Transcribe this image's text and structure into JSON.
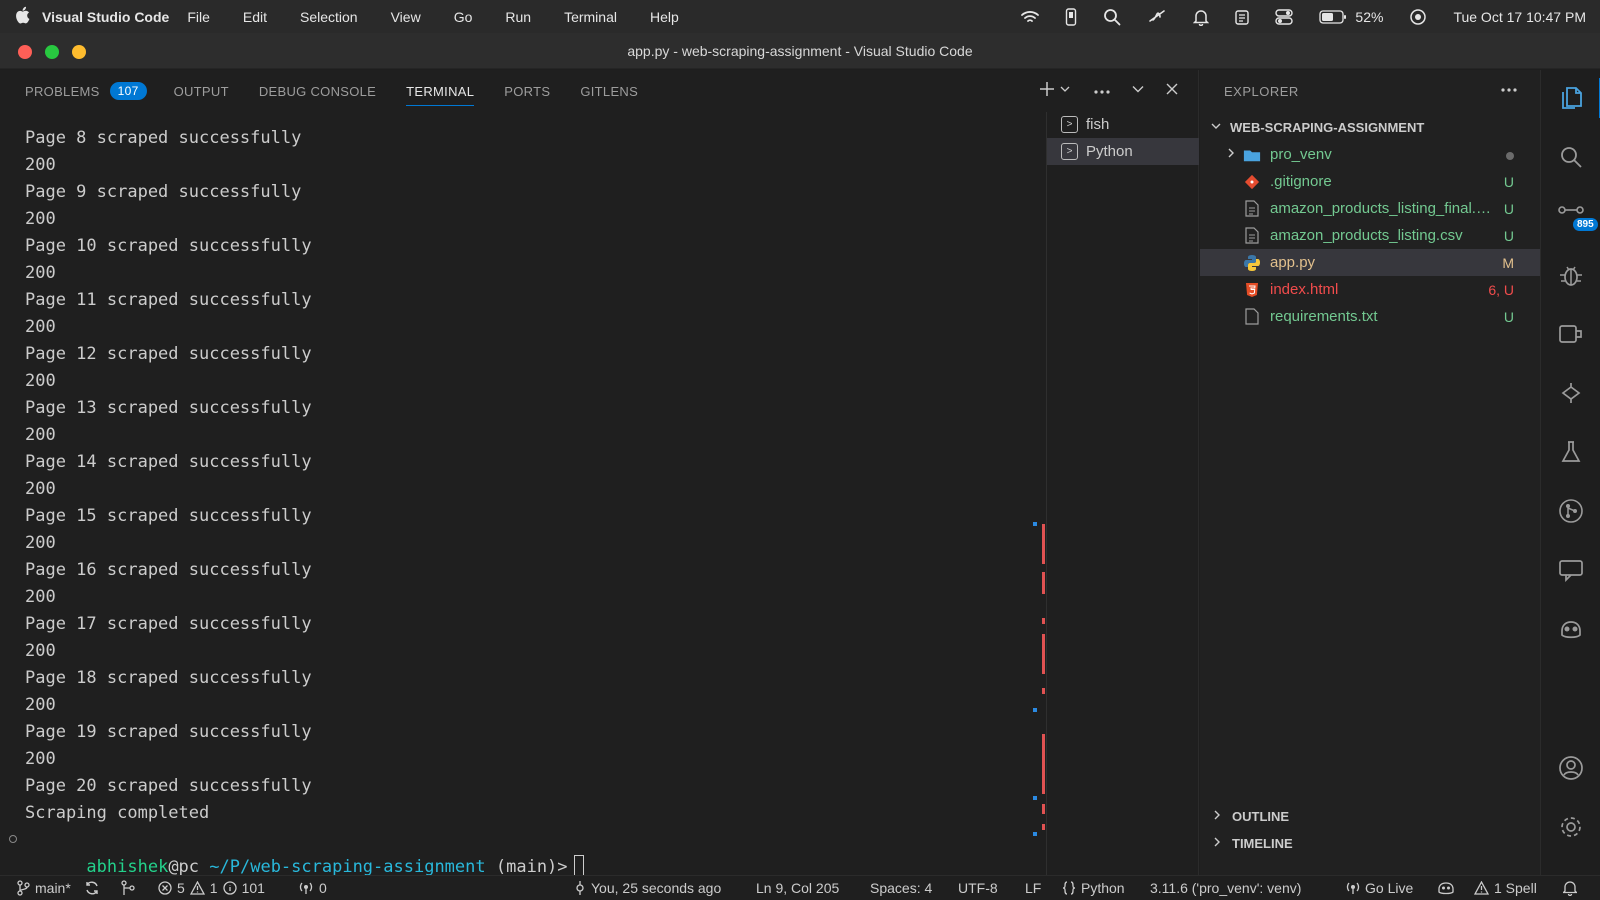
{
  "menubar": {
    "app_name": "Visual Studio Code",
    "items": [
      "File",
      "Edit",
      "Selection",
      "View",
      "Go",
      "Run",
      "Terminal",
      "Help"
    ],
    "battery": "52%",
    "datetime": "Tue Oct 17  10:47 PM"
  },
  "window": {
    "title": "app.py - web-scraping-assignment - Visual Studio Code"
  },
  "panel": {
    "tabs": [
      {
        "label": "PROBLEMS",
        "badge": "107"
      },
      {
        "label": "OUTPUT"
      },
      {
        "label": "DEBUG CONSOLE"
      },
      {
        "label": "TERMINAL",
        "active": true
      },
      {
        "label": "PORTS"
      },
      {
        "label": "GITLENS"
      }
    ]
  },
  "terminal": {
    "lines": [
      "Page 8 scraped successfully",
      "200",
      "Page 9 scraped successfully",
      "200",
      "Page 10 scraped successfully",
      "200",
      "Page 11 scraped successfully",
      "200",
      "Page 12 scraped successfully",
      "200",
      "Page 13 scraped successfully",
      "200",
      "Page 14 scraped successfully",
      "200",
      "Page 15 scraped successfully",
      "200",
      "Page 16 scraped successfully",
      "200",
      "Page 17 scraped successfully",
      "200",
      "Page 18 scraped successfully",
      "200",
      "Page 19 scraped successfully",
      "200",
      "Page 20 scraped successfully",
      "Scraping completed"
    ],
    "prompt": {
      "user": "abhishek",
      "host": "@pc",
      "path": "~/P/web-scraping-assignment",
      "branch": "(main)>"
    },
    "instances": [
      {
        "label": "fish"
      },
      {
        "label": "Python",
        "active": true
      }
    ]
  },
  "explorer": {
    "header": "EXPLORER",
    "folder": "WEB-SCRAPING-ASSIGNMENT",
    "files": [
      {
        "name": "pro_venv",
        "status": "",
        "icon": "folder-icon"
      },
      {
        "name": ".gitignore",
        "status": "U",
        "icon": "git-icon"
      },
      {
        "name": "amazon_products_listing_final.csv",
        "status": "U",
        "icon": "file-icon"
      },
      {
        "name": "amazon_products_listing.csv",
        "status": "U",
        "icon": "file-icon"
      },
      {
        "name": "app.py",
        "status": "M",
        "icon": "python-icon"
      },
      {
        "name": "index.html",
        "status": "6, U",
        "icon": "html-icon"
      },
      {
        "name": "requirements.txt",
        "status": "U",
        "icon": "file-icon"
      }
    ],
    "sections": [
      "OUTLINE",
      "TIMELINE"
    ]
  },
  "activity": {
    "source_control_badge": "895"
  },
  "statusbar": {
    "branch": "main*",
    "errors": "5",
    "warnings": "1",
    "info": "101",
    "ports": "0",
    "blame": "You, 25 seconds ago",
    "position": "Ln 9, Col 205",
    "spaces": "Spaces: 4",
    "encoding": "UTF-8",
    "eol": "LF",
    "language": "Python",
    "interpreter": "3.11.6 ('pro_venv': venv)",
    "golive": "Go Live",
    "spell": "1 Spell"
  }
}
